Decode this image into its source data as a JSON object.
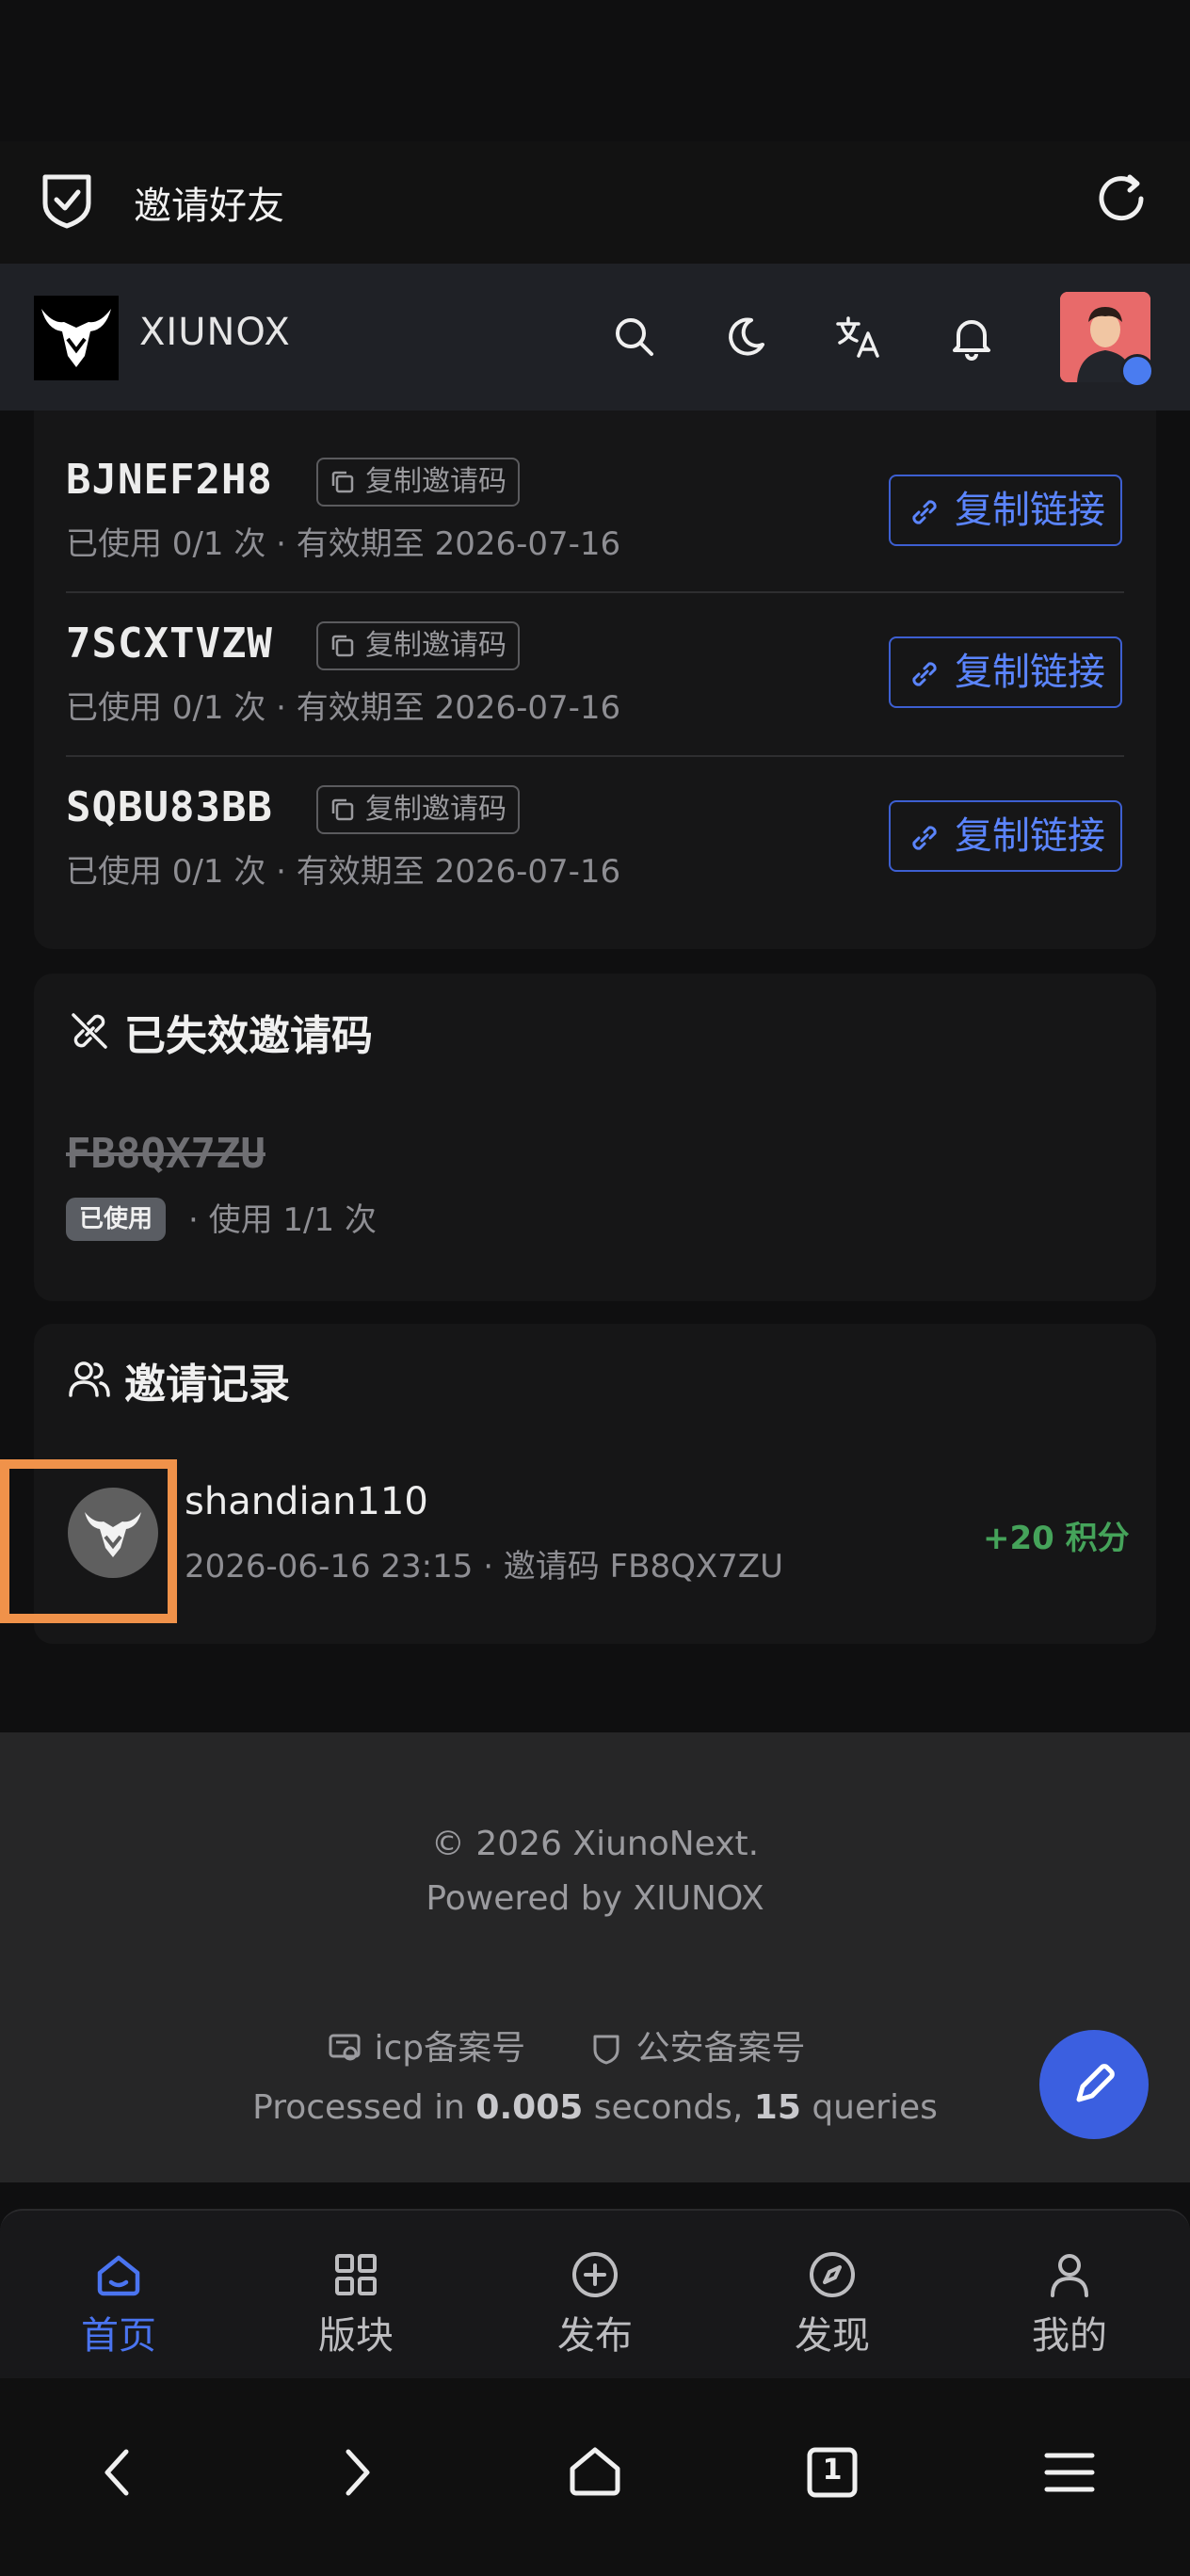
{
  "browser": {
    "title": "邀请好友"
  },
  "header": {
    "site_name": "XIUNOX"
  },
  "active_codes": [
    {
      "code": "BJNEF2H8",
      "copy_code_label": "复制邀请码",
      "meta": "已使用 0/1 次 · 有效期至 2026-07-16",
      "copy_link_label": "复制链接"
    },
    {
      "code": "7SCXTVZW",
      "copy_code_label": "复制邀请码",
      "meta": "已使用 0/1 次 · 有效期至 2026-07-16",
      "copy_link_label": "复制链接"
    },
    {
      "code": "SQBU83BB",
      "copy_code_label": "复制邀请码",
      "meta": "已使用 0/1 次 · 有效期至 2026-07-16",
      "copy_link_label": "复制链接"
    }
  ],
  "expired": {
    "title": "已失效邀请码",
    "items": [
      {
        "code": "FB8QX7ZU",
        "badge": "已使用",
        "usage": "· 使用 1/1 次"
      }
    ]
  },
  "records": {
    "title": "邀请记录",
    "items": [
      {
        "username": "shandian110",
        "meta": "2026-06-16 23:15 · 邀请码 FB8QX7ZU",
        "points": "+20 积分"
      }
    ]
  },
  "footer": {
    "copyright": "© 2026 XiunoNext.",
    "powered": "Powered by XIUNOX",
    "icp": "icp备案号",
    "police": "公安备案号",
    "processed_prefix": "Processed in ",
    "seconds": "0.005",
    "seconds_suffix": " seconds, ",
    "queries": "15",
    "queries_suffix": " queries"
  },
  "bottom_nav": [
    {
      "label": "首页",
      "icon": "home-icon",
      "active": true
    },
    {
      "label": "版块",
      "icon": "grid-icon",
      "active": false
    },
    {
      "label": "发布",
      "icon": "plus-circle-icon",
      "active": false
    },
    {
      "label": "发现",
      "icon": "compass-icon",
      "active": false
    },
    {
      "label": "我的",
      "icon": "user-icon",
      "active": false
    }
  ],
  "system_nav": {
    "tab_count": "1"
  },
  "colors": {
    "accent": "#4a74f0",
    "success": "#45a35a",
    "highlight": "#f0924a"
  }
}
